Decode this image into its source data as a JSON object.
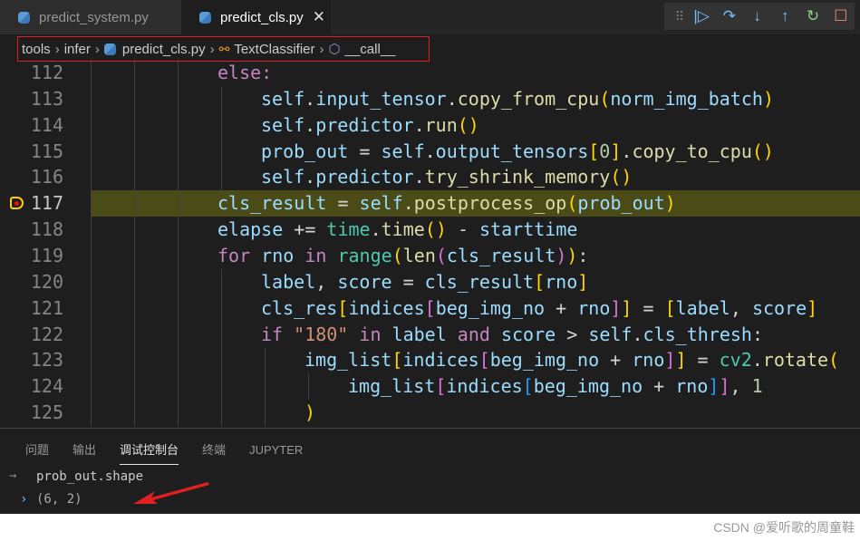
{
  "tabs": [
    {
      "label": "predict_system.py",
      "active": false
    },
    {
      "label": "predict_cls.py",
      "active": true
    }
  ],
  "debug_toolbar": [
    "grip-icon",
    "continue-icon",
    "step-over-icon",
    "step-into-icon",
    "step-out-icon",
    "restart-icon",
    "stop-icon"
  ],
  "breadcrumb": {
    "items": [
      "tools",
      "infer",
      "predict_cls.py",
      "TextClassifier",
      "__call__"
    ]
  },
  "editor": {
    "current_line": 117,
    "lines": [
      {
        "n": "112",
        "i": 3,
        "t": [
          [
            "else:",
            "kw"
          ]
        ]
      },
      {
        "n": "113",
        "i": 4,
        "t": [
          [
            "self",
            "v"
          ],
          [
            ".",
            "o"
          ],
          [
            "input_tensor",
            "v"
          ],
          [
            ".",
            "o"
          ],
          [
            "copy_from_cpu",
            "f"
          ],
          [
            "(",
            "b1"
          ],
          [
            "norm_img_batch",
            "v"
          ],
          [
            ")",
            "b1"
          ]
        ]
      },
      {
        "n": "114",
        "i": 4,
        "t": [
          [
            "self",
            "v"
          ],
          [
            ".",
            "o"
          ],
          [
            "predictor",
            "v"
          ],
          [
            ".",
            "o"
          ],
          [
            "run",
            "f"
          ],
          [
            "()",
            "b1"
          ]
        ]
      },
      {
        "n": "115",
        "i": 4,
        "t": [
          [
            "prob_out",
            "v"
          ],
          [
            " = ",
            "o"
          ],
          [
            "self",
            "v"
          ],
          [
            ".",
            "o"
          ],
          [
            "output_tensors",
            "v"
          ],
          [
            "[",
            "b1"
          ],
          [
            "0",
            "n"
          ],
          [
            "]",
            "b1"
          ],
          [
            ".",
            "o"
          ],
          [
            "copy_to_cpu",
            "f"
          ],
          [
            "()",
            "b1"
          ]
        ]
      },
      {
        "n": "116",
        "i": 4,
        "t": [
          [
            "self",
            "v"
          ],
          [
            ".",
            "o"
          ],
          [
            "predictor",
            "v"
          ],
          [
            ".",
            "o"
          ],
          [
            "try_shrink_memory",
            "f"
          ],
          [
            "()",
            "b1"
          ]
        ]
      },
      {
        "n": "117",
        "i": 3,
        "t": [
          [
            "cls_result",
            "v"
          ],
          [
            " = ",
            "o"
          ],
          [
            "self",
            "v"
          ],
          [
            ".",
            "o"
          ],
          [
            "postprocess_op",
            "f"
          ],
          [
            "(",
            "b1"
          ],
          [
            "prob_out",
            "v"
          ],
          [
            ")",
            "b1"
          ]
        ]
      },
      {
        "n": "118",
        "i": 3,
        "t": [
          [
            "elapse",
            "v"
          ],
          [
            " += ",
            "o"
          ],
          [
            "time",
            "c"
          ],
          [
            ".",
            "o"
          ],
          [
            "time",
            "f"
          ],
          [
            "()",
            "b1"
          ],
          [
            " - ",
            "o"
          ],
          [
            "starttime",
            "v"
          ]
        ]
      },
      {
        "n": "119",
        "i": 3,
        "t": [
          [
            "for",
            "kw"
          ],
          [
            " ",
            "o"
          ],
          [
            "rno",
            "v"
          ],
          [
            " in ",
            "kw"
          ],
          [
            "range",
            "c"
          ],
          [
            "(",
            "b1"
          ],
          [
            "len",
            "f"
          ],
          [
            "(",
            "b2"
          ],
          [
            "cls_result",
            "v"
          ],
          [
            ")",
            "b2"
          ],
          [
            ")",
            "b1"
          ],
          [
            ":",
            "o"
          ]
        ]
      },
      {
        "n": "120",
        "i": 4,
        "t": [
          [
            "label",
            "v"
          ],
          [
            ", ",
            "o"
          ],
          [
            "score",
            "v"
          ],
          [
            " = ",
            "o"
          ],
          [
            "cls_result",
            "v"
          ],
          [
            "[",
            "b1"
          ],
          [
            "rno",
            "v"
          ],
          [
            "]",
            "b1"
          ]
        ]
      },
      {
        "n": "121",
        "i": 4,
        "t": [
          [
            "cls_res",
            "v"
          ],
          [
            "[",
            "b1"
          ],
          [
            "indices",
            "v"
          ],
          [
            "[",
            "b2"
          ],
          [
            "beg_img_no",
            "v"
          ],
          [
            " + ",
            "o"
          ],
          [
            "rno",
            "v"
          ],
          [
            "]",
            "b2"
          ],
          [
            "]",
            "b1"
          ],
          [
            " = ",
            "o"
          ],
          [
            "[",
            "b1"
          ],
          [
            "label",
            "v"
          ],
          [
            ", ",
            "o"
          ],
          [
            "score",
            "v"
          ],
          [
            "]",
            "b1"
          ]
        ]
      },
      {
        "n": "122",
        "i": 4,
        "t": [
          [
            "if",
            "kw"
          ],
          [
            " ",
            "o"
          ],
          [
            "\"180\"",
            "s"
          ],
          [
            " in ",
            "kw"
          ],
          [
            "label",
            "v"
          ],
          [
            " and ",
            "kw"
          ],
          [
            "score",
            "v"
          ],
          [
            " > ",
            "o"
          ],
          [
            "self",
            "v"
          ],
          [
            ".",
            "o"
          ],
          [
            "cls_thresh",
            "v"
          ],
          [
            ":",
            "o"
          ]
        ]
      },
      {
        "n": "123",
        "i": 5,
        "t": [
          [
            "img_list",
            "v"
          ],
          [
            "[",
            "b1"
          ],
          [
            "indices",
            "v"
          ],
          [
            "[",
            "b2"
          ],
          [
            "beg_img_no",
            "v"
          ],
          [
            " + ",
            "o"
          ],
          [
            "rno",
            "v"
          ],
          [
            "]",
            "b2"
          ],
          [
            "]",
            "b1"
          ],
          [
            " = ",
            "o"
          ],
          [
            "cv2",
            "c"
          ],
          [
            ".",
            "o"
          ],
          [
            "rotate",
            "f"
          ],
          [
            "(",
            "b1"
          ]
        ]
      },
      {
        "n": "124",
        "i": 6,
        "t": [
          [
            "img_list",
            "v"
          ],
          [
            "[",
            "b2"
          ],
          [
            "indices",
            "v"
          ],
          [
            "[",
            "b3"
          ],
          [
            "beg_img_no",
            "v"
          ],
          [
            " + ",
            "o"
          ],
          [
            "rno",
            "v"
          ],
          [
            "]",
            "b3"
          ],
          [
            "]",
            "b2"
          ],
          [
            ", ",
            "o"
          ],
          [
            "1",
            "n"
          ]
        ]
      },
      {
        "n": "125",
        "i": 5,
        "t": [
          [
            ")",
            "b1"
          ]
        ]
      }
    ]
  },
  "panel": {
    "tabs": [
      "问题",
      "输出",
      "调试控制台",
      "终端",
      "JUPYTER"
    ],
    "active_tab": "调试控制台",
    "console": {
      "input": "prob_out.shape",
      "output": "(6, 2)"
    }
  },
  "annotation_color": "#e02020",
  "watermark": "CSDN @爱听歌的周童鞋"
}
